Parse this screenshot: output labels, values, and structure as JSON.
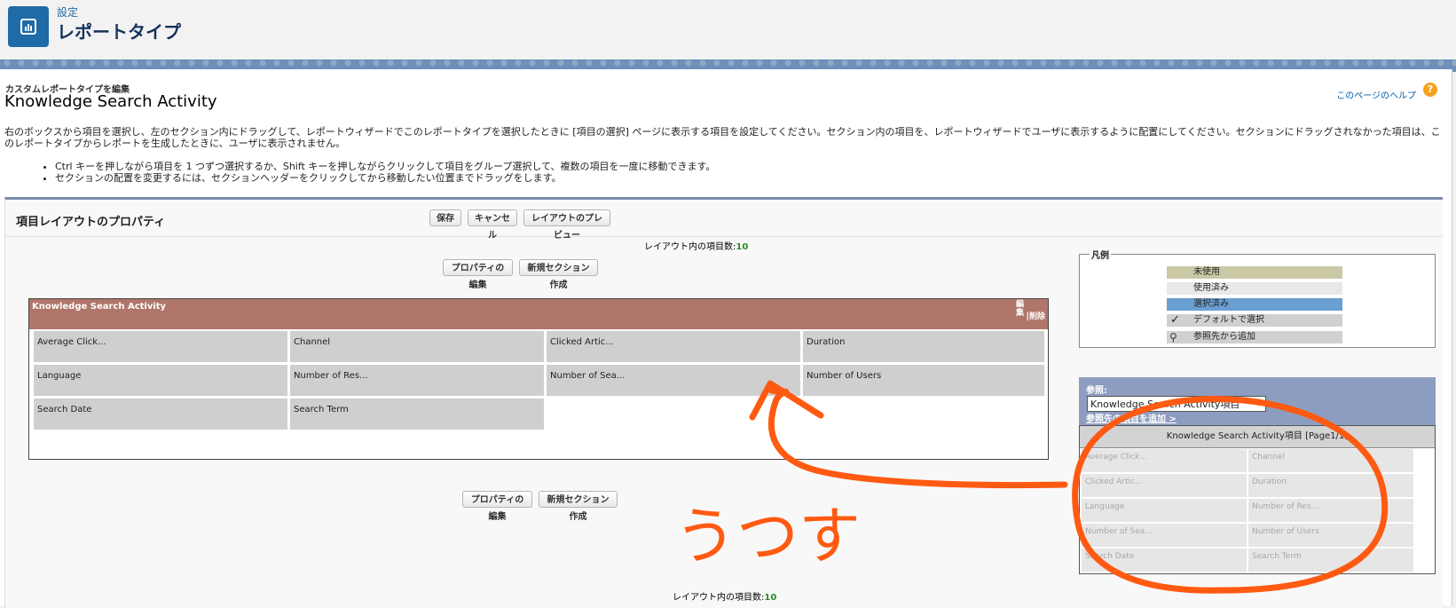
{
  "header": {
    "breadcrumb": "設定",
    "title": "レポートタイプ"
  },
  "content": {
    "subtitle": "カスタムレポートタイプを編集",
    "title": "Knowledge Search Activity",
    "help_link": "このページのヘルプ",
    "description": "右のボックスから項目を選択し、左のセクション内にドラッグして、レポートウィザードでこのレポートタイプを選択したときに [項目の選択] ページに表示する項目を設定してください。セクション内の項目を、レポートウィザードでユーザに表示するように配置にしてください。セクションにドラッグされなかった項目は、このレポートタイプからレポートを生成したときに、ユーザに表示されません。",
    "bullets": [
      "Ctrl キーを押しながら項目を 1 つずつ選択するか、Shift キーを押しながらクリックして項目をグループ選択して、複数の項目を一度に移動できます。",
      "セクションの配置を変更するには、セクションヘッダーをクリックしてから移動したい位置までドラッグをします。"
    ]
  },
  "panel": {
    "title": "項目レイアウトのプロパティ",
    "save": "保存",
    "cancel": "キャンセル",
    "preview": "レイアウトのプレビュー",
    "count_label": "レイアウト内の項目数:",
    "count_value": "10",
    "edit_props": "プロパティの編集",
    "new_section": "新規セクション作成"
  },
  "section": {
    "title": "Knowledge Search Activity",
    "edit": "編集",
    "delete": "削除",
    "fields": [
      "Average Click...",
      "Channel",
      "Clicked Artic...",
      "Duration",
      "Language",
      "Number of Res...",
      "Number of Sea...",
      "Number of Users",
      "Search Date",
      "Search Term"
    ]
  },
  "legend": {
    "title": "凡例",
    "items": [
      "未使用",
      "使用済み",
      "選択済み",
      "デフォルトで選択",
      "参照先から追加"
    ],
    "colors": {
      "unused": "#cbc8a6",
      "used": "#e8e8e8",
      "selected": "#6a9fd1"
    }
  },
  "reference": {
    "label": "参照:",
    "selected": "Knowledge Search Activity項目",
    "add_link": "参照先の項目を追加 >",
    "list_title": "Knowledge Search Activity項目",
    "page": "[Page1/1]",
    "fields": [
      "Average Click...",
      "Channel",
      "Clicked Artic...",
      "Duration",
      "Language",
      "Number of Res...",
      "Number of Sea...",
      "Number of Users",
      "Search Date",
      "Search Term"
    ]
  },
  "annotation": {
    "text": "うつす",
    "color": "#ff5a12"
  }
}
